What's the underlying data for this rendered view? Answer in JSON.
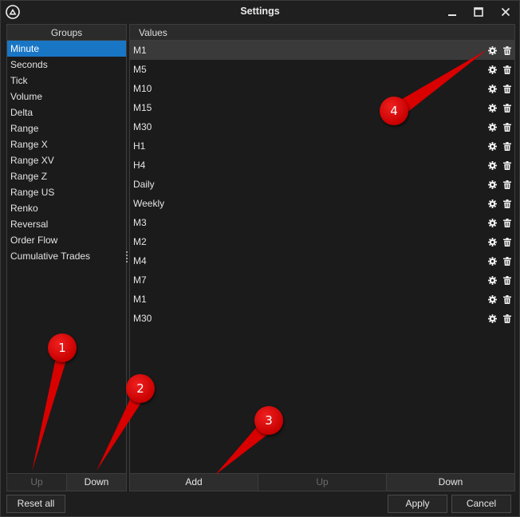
{
  "window": {
    "title": "Settings"
  },
  "groups": {
    "header": "Groups",
    "items": [
      "Minute",
      "Seconds",
      "Tick",
      "Volume",
      "Delta",
      "Range",
      "Range X",
      "Range XV",
      "Range Z",
      "Range US",
      "Renko",
      "Reversal",
      "Order Flow",
      "Cumulative Trades"
    ],
    "selected": "Minute",
    "up_label": "Up",
    "down_label": "Down"
  },
  "values": {
    "header": "Values",
    "items": [
      "M1",
      "M5",
      "M10",
      "M15",
      "M30",
      "H1",
      "H4",
      "Daily",
      "Weekly",
      "M3",
      "M2",
      "M4",
      "M7",
      "M1",
      "M30"
    ],
    "selected_index": 0,
    "add_label": "Add",
    "up_label": "Up",
    "down_label": "Down"
  },
  "footer": {
    "reset_label": "Reset all",
    "apply_label": "Apply",
    "cancel_label": "Cancel"
  },
  "annotations": [
    "1",
    "2",
    "3",
    "4"
  ],
  "colors": {
    "selection": "#1976c5",
    "marker": "#d40000",
    "background": "#1e1e1e"
  }
}
